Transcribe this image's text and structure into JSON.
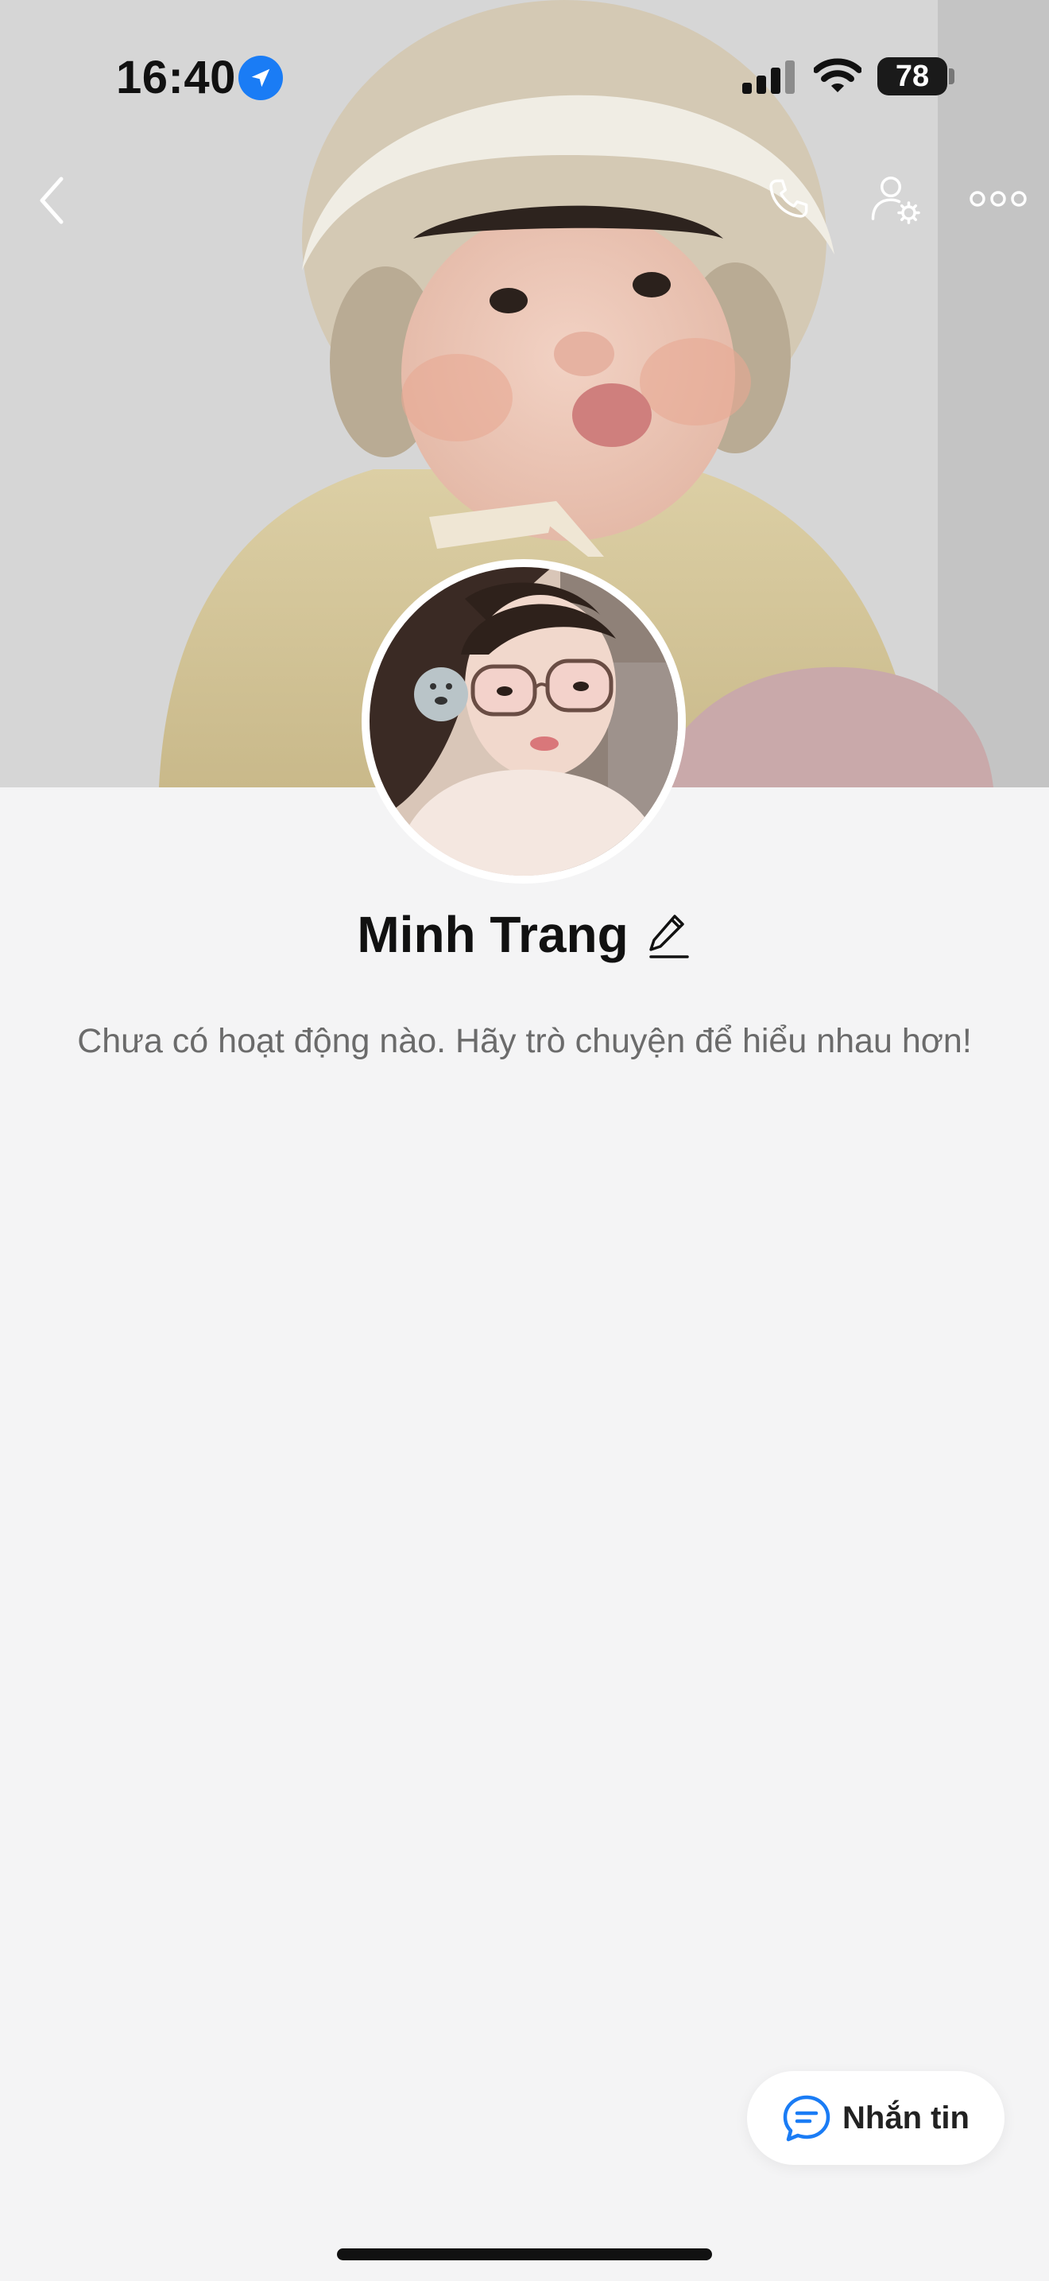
{
  "status_bar": {
    "time": "16:40",
    "location_icon": "location-arrow-icon",
    "signal_icon": "cellular-signal-icon",
    "wifi_icon": "wifi-icon",
    "battery_level": "78"
  },
  "nav": {
    "back_icon": "chevron-left-icon",
    "call_icon": "phone-icon",
    "settings_icon": "user-settings-icon",
    "more_icon": "more-horizontal-icon"
  },
  "profile": {
    "name": "Minh Trang",
    "edit_icon": "pencil-icon",
    "empty_activity_text": "Chưa có hoạt động nào. Hãy trò chuyện để hiểu nhau hơn!"
  },
  "fab": {
    "label": "Nhắn tin",
    "icon": "chat-bubble-icon"
  },
  "colors": {
    "accent": "#1a7cf5",
    "background": "#f4f4f5",
    "text_primary": "#111111",
    "text_secondary": "#6b6b6b"
  }
}
